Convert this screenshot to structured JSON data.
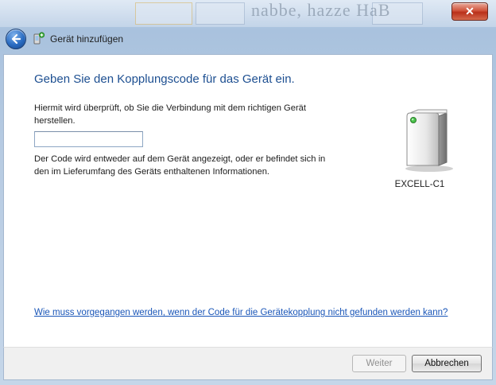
{
  "window": {
    "title": "Gerät hinzufügen",
    "close_glyph": "✕"
  },
  "background_blur_text": "nabbe, hazze HaB",
  "icons": {
    "back": "back-arrow-icon",
    "title": "bluetooth-device-add-icon",
    "device": "computer-tower-icon",
    "close": "close-icon"
  },
  "content": {
    "heading": "Geben Sie den Kopplungscode für das Gerät ein.",
    "description": "Hiermit wird überprüft, ob Sie die Verbindung mit dem richtigen Gerät herstellen.",
    "code_input_value": "",
    "hint": "Der Code wird entweder auf dem Gerät angezeigt, oder er befindet sich in den im Lieferumfang des Geräts enthaltenen Informationen.",
    "help_link": "Wie muss vorgegangen werden, wenn der Code für die Gerätekopplung nicht gefunden werden kann?"
  },
  "device": {
    "name": "EXCELL-C1"
  },
  "buttons": {
    "next": "Weiter",
    "cancel": "Abbrechen"
  },
  "colors": {
    "heading": "#1d4f91",
    "link": "#1a56b8",
    "close_button": "#c8432a"
  }
}
